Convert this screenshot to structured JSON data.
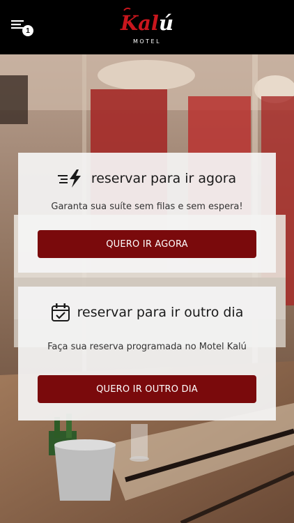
{
  "header": {
    "menu_icon": "menu-list-icon",
    "notification_count": "1",
    "logo": {
      "brand": "Kalú",
      "subtitle": "MOTEL"
    }
  },
  "cards": [
    {
      "icon": "fast-lightning-icon",
      "title": "reservar para ir agora",
      "subtitle": "Garanta sua suíte sem filas e sem espera!",
      "button_label": "QUERO IR AGORA"
    },
    {
      "icon": "calendar-check-icon",
      "title": "reservar para ir outro dia",
      "subtitle": "Faça sua reserva programada no Motel Kalú",
      "button_label": "QUERO IR OUTRO DIA"
    }
  ],
  "colors": {
    "header_bg": "#000000",
    "brand_red": "#c8161d",
    "button_bg": "#7a0a0c",
    "card_bg": "#f4f4f4"
  }
}
